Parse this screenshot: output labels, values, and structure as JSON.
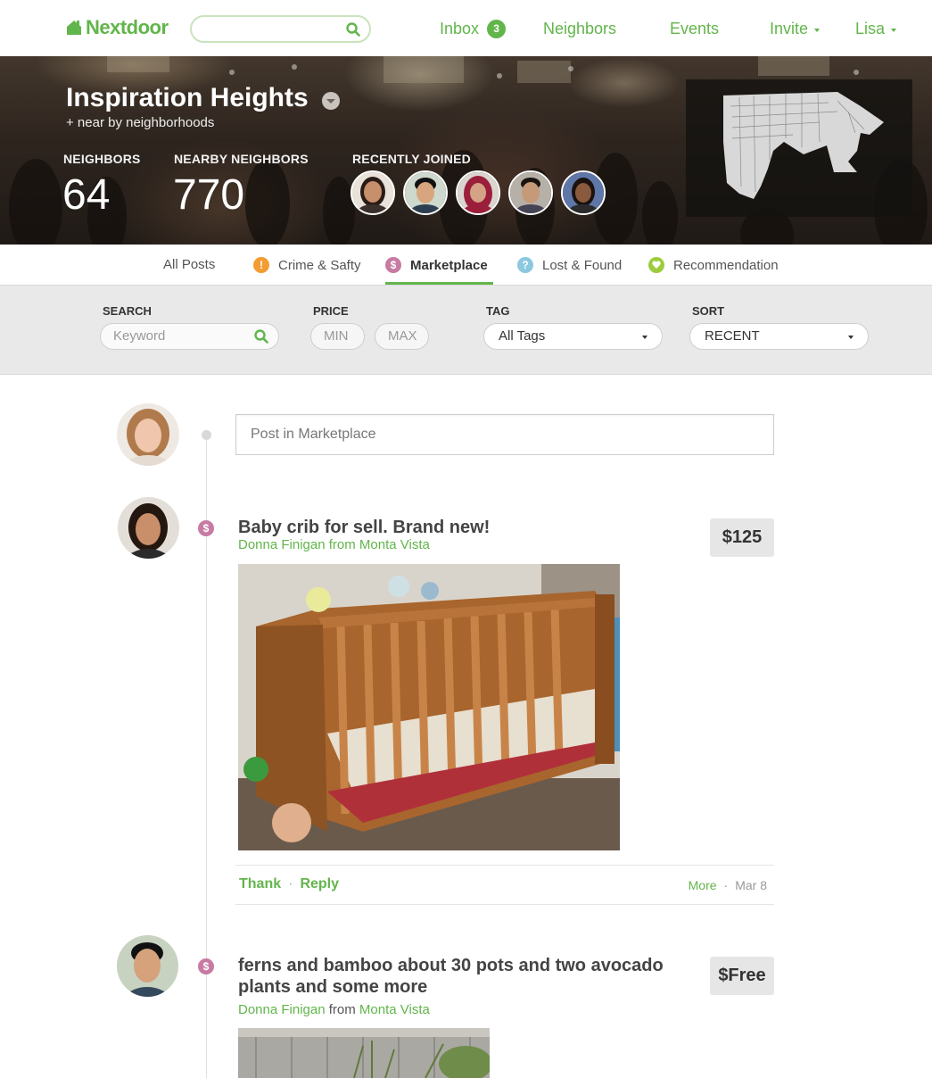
{
  "nav": {
    "logo_text": "Nextdoor",
    "search_placeholder": "",
    "inbox_label": "Inbox",
    "inbox_count": "3",
    "neighbors_label": "Neighbors",
    "events_label": "Events",
    "invite_label": "Invite",
    "user_label": "Lisa",
    "brand_color": "#62b54b"
  },
  "hero": {
    "neighborhood": "Inspiration Heights",
    "subtitle": "+ near by neighborhoods",
    "neighbors_label": "NEIGHBORS",
    "neighbors_count": "64",
    "nearby_label": "NEARBY NEIGHBORS",
    "nearby_count": "770",
    "recently_joined_label": "RECENTLY JOINED"
  },
  "tabs": [
    {
      "label": "All Posts",
      "icon": "none"
    },
    {
      "label": "Crime & Safty",
      "icon": "alert-icon",
      "color": "#f39c33"
    },
    {
      "label": "Marketplace",
      "icon": "dollar-icon",
      "color": "#c77ba3",
      "active": true
    },
    {
      "label": "Lost & Found",
      "icon": "question-icon",
      "color": "#8cc8e0"
    },
    {
      "label": "Recommendation",
      "icon": "heart-icon",
      "color": "#9ccc3c"
    }
  ],
  "filters": {
    "search_label": "SEARCH",
    "search_placeholder": "Keyword",
    "price_label": "PRICE",
    "min_placeholder": "MIN",
    "max_placeholder": "MAX",
    "tag_label": "TAG",
    "tag_value": "All Tags",
    "sort_label": "SORT",
    "sort_value": "RECENT"
  },
  "composer": {
    "placeholder": "Post in Marketplace"
  },
  "posts": [
    {
      "title": "Baby crib for sell. Brand new!",
      "author": "Donna Finigan",
      "from_word": "from",
      "location": "Monta Vista",
      "price": "$125",
      "thank": "Thank",
      "reply": "Reply",
      "more": "More",
      "date": "Mar 8"
    },
    {
      "title_line1": "ferns and bamboo about 30 pots and two avocado",
      "title_line2": "plants and some more",
      "author": "Donna Finigan",
      "from_word": "from",
      "location": "Monta Vista",
      "price": "$Free"
    }
  ]
}
